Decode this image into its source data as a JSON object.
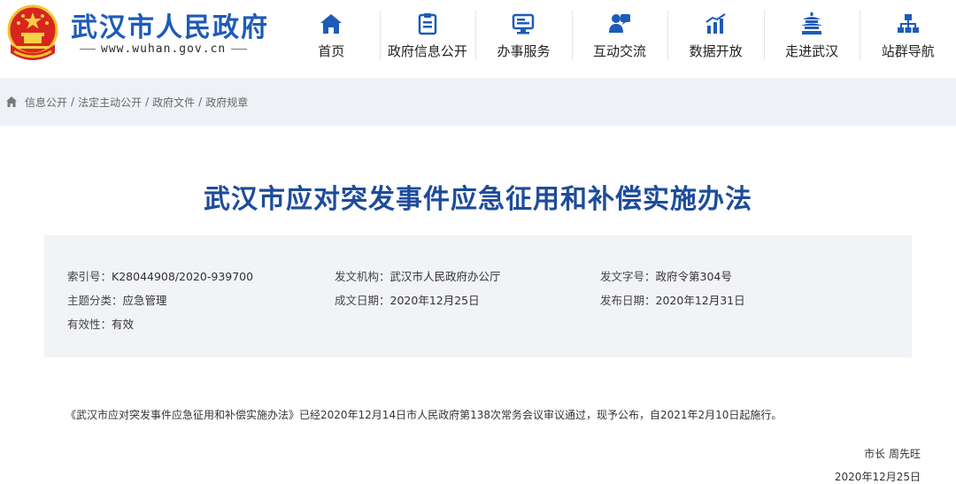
{
  "header": {
    "site_name": "武汉市人民政府",
    "site_url": "www.wuhan.gov.cn",
    "emblem_icon": "national-emblem-icon",
    "brand_color": "#1e5bb8",
    "nav": [
      {
        "label": "首页",
        "icon": "home-icon"
      },
      {
        "label": "政府信息公开",
        "icon": "document-icon"
      },
      {
        "label": "办事服务",
        "icon": "monitor-icon"
      },
      {
        "label": "互动交流",
        "icon": "chat-icon"
      },
      {
        "label": "数据开放",
        "icon": "data-chart-icon"
      },
      {
        "label": "走进武汉",
        "icon": "pavilion-icon"
      },
      {
        "label": "站群导航",
        "icon": "sitemap-icon"
      }
    ]
  },
  "breadcrumb": {
    "items": [
      "信息公开",
      "法定主动公开",
      "政府文件",
      "政府规章"
    ],
    "separator": "/"
  },
  "document": {
    "title": "武汉市应对突发事件应急征用和补偿实施办法",
    "meta": {
      "index_label": "索引号：",
      "index_value": "K28044908/2020-939700",
      "issuer_label": "发文机构：",
      "issuer_value": "武汉市人民政府办公厅",
      "doc_no_label": "发文字号：",
      "doc_no_value": "政府令第304号",
      "topic_label": "主题分类：",
      "topic_value": "应急管理",
      "created_label": "成文日期：",
      "created_value": "2020年12月25日",
      "published_label": "发布日期：",
      "published_value": "2020年12月31日",
      "validity_label": "有效性：",
      "validity_value": "有效"
    },
    "body": "《武汉市应对突发事件应急征用和补偿实施办法》已经2020年12月14日市人民政府第138次常务会议审议通过，现予公布，自2021年2月10日起施行。",
    "signer": "市长  周先旺",
    "sign_date": "2020年12月25日"
  }
}
